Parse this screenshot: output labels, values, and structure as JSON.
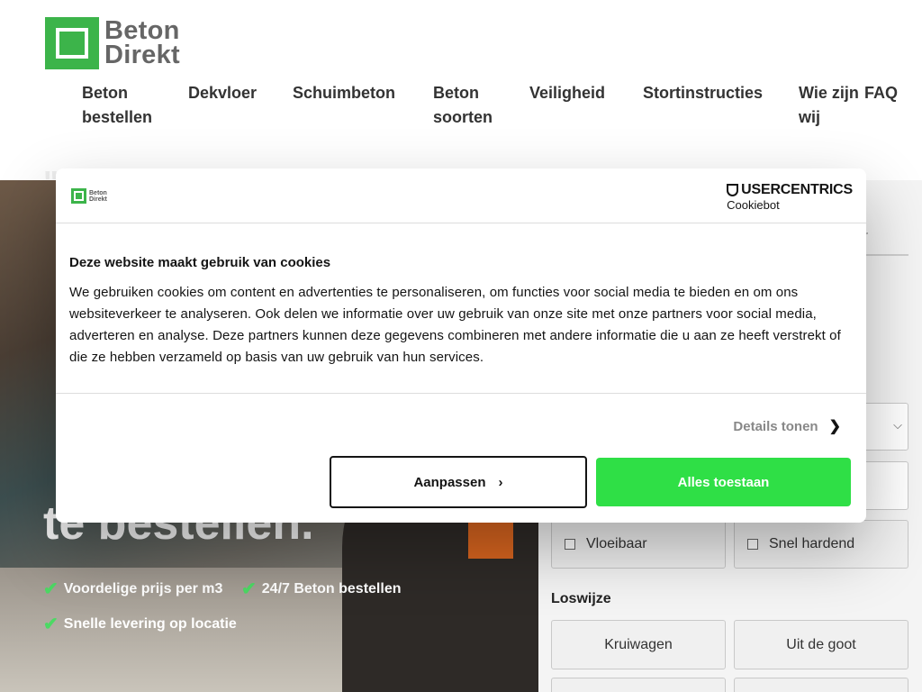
{
  "logo": {
    "line1": "Beton",
    "line2": "Direkt",
    "brand_color": "#3cb44a"
  },
  "nav": [
    {
      "label": "Beton bestellen"
    },
    {
      "label": "Dekvloer"
    },
    {
      "label": "Schuimbeton"
    },
    {
      "label": "Beton soorten"
    },
    {
      "label": "Veiligheid"
    },
    {
      "label": "Stortinstructies"
    },
    {
      "label": "Wie zijn wij"
    },
    {
      "label": "FAQ"
    }
  ],
  "hero": {
    "quote_mark": "\"",
    "title": "te bestellen.",
    "usps": [
      {
        "icon": "check-icon",
        "label": "Voordelige prijs per m3"
      },
      {
        "icon": "check-icon",
        "label": "24/7 Beton bestellen"
      },
      {
        "icon": "check-icon",
        "label": "Snelle levering op locatie"
      }
    ]
  },
  "form": {
    "tab_partial": "er",
    "options": [
      {
        "label": "Vloeibaar"
      },
      {
        "label": "Snel hardend"
      }
    ],
    "loswijze_label": "Loswijze",
    "loswijze": [
      {
        "label": "Kruiwagen"
      },
      {
        "label": "Uit de goot"
      }
    ]
  },
  "cookie": {
    "logo_line1": "Beton",
    "logo_line2": "Direkt",
    "provider_top": "USERCENTRICS",
    "provider_bottom": "Cookiebot",
    "title": "Deze website maakt gebruik van cookies",
    "text": "We gebruiken cookies om content en advertenties te personaliseren, om functies voor social media te bieden en om ons websiteverkeer te analyseren. Ook delen we informatie over uw gebruik van onze site met onze partners voor social media, adverteren en analyse. Deze partners kunnen deze gegevens combineren met andere informatie die u aan ze heeft verstrekt of die ze hebben verzameld op basis van uw gebruik van hun services.",
    "details_label": "Details tonen",
    "customize_label": "Aanpassen",
    "allow_label": "Alles toestaan",
    "allow_color": "#2fdf46"
  }
}
